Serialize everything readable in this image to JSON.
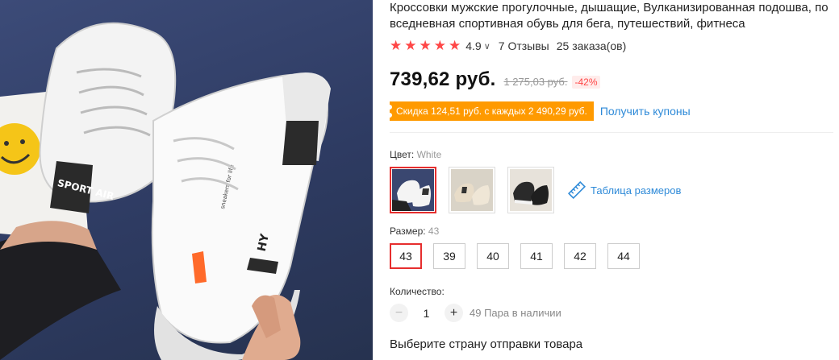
{
  "product": {
    "title": "Кроссовки мужские прогулочные, дышащие, Вулканизированная подошва, повседневная спортивная обувь для бега, путешествий, фитнеса",
    "rating": "4.9",
    "reviews": "7 Отзывы",
    "orders": "25 заказа(ов)",
    "stars": [
      "★",
      "★",
      "★",
      "★",
      "★"
    ],
    "price": "739,62 руб.",
    "old_price": "1 275,03 руб.",
    "discount": "-42%",
    "coupon_text": "Скидка 124,51 руб. с каждых 2 490,29 руб.",
    "get_coupons": "Получить купоны",
    "shoe_print": {
      "tongue": "SPORT AIR",
      "side": "HY",
      "side_text": "sneakers for life"
    }
  },
  "color": {
    "label": "Цвет:",
    "selected": "White",
    "swatches": [
      {
        "name": "White",
        "shoe": "#f4f4f4",
        "bg": "#3a4770"
      },
      {
        "name": "Beige",
        "shoe": "#e8dcc8",
        "bg": "#d9d3c7"
      },
      {
        "name": "Black",
        "shoe": "#2a2a2a",
        "bg": "#e7e2da"
      }
    ],
    "size_chart": "Таблица размеров"
  },
  "size": {
    "label": "Размер:",
    "selected": "43",
    "options": [
      "43",
      "39",
      "40",
      "41",
      "42",
      "44"
    ]
  },
  "quantity": {
    "label": "Количество:",
    "minus": "−",
    "plus": "+",
    "value": "1",
    "stock": "49 Пара в наличии"
  },
  "shipping": {
    "label": "Выберите страну отправки товара"
  },
  "colors": {
    "accent_red": "#ff4747",
    "coupon_orange": "#ff9a00",
    "link_blue": "#2e8ad8"
  }
}
